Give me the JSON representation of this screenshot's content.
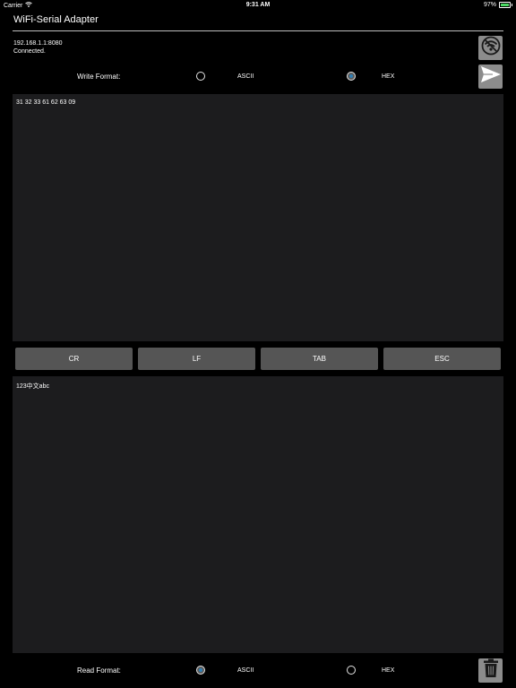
{
  "status_bar": {
    "carrier": "Carrier",
    "time": "9:31 AM",
    "battery": "97%",
    "battery_level": 0.97
  },
  "header": {
    "title": "WiFi-Serial Adapter"
  },
  "connection": {
    "address": "192.168.1.1:8080",
    "status": "Connected."
  },
  "write_format": {
    "label": "Write Format:",
    "options": [
      "ASCII",
      "HEX"
    ],
    "selected": "HEX"
  },
  "write_area": {
    "value": "31 32 33 61 62 63 09"
  },
  "keys": [
    "CR",
    "LF",
    "TAB",
    "ESC"
  ],
  "read_area": {
    "value": "123中文abc"
  },
  "read_format": {
    "label": "Read Format:",
    "options": [
      "ASCII",
      "HEX"
    ],
    "selected": "ASCII"
  },
  "icons": {
    "disconnect": "wifi-off-icon",
    "send": "send-icon",
    "clear": "trash-icon"
  },
  "colors": {
    "background": "#000000",
    "panel": "#1c1c1e",
    "icon_button": "#8c8c8c",
    "key_button": "#555555",
    "radio_selected": "#2f7fb4",
    "battery": "#4cd964"
  }
}
